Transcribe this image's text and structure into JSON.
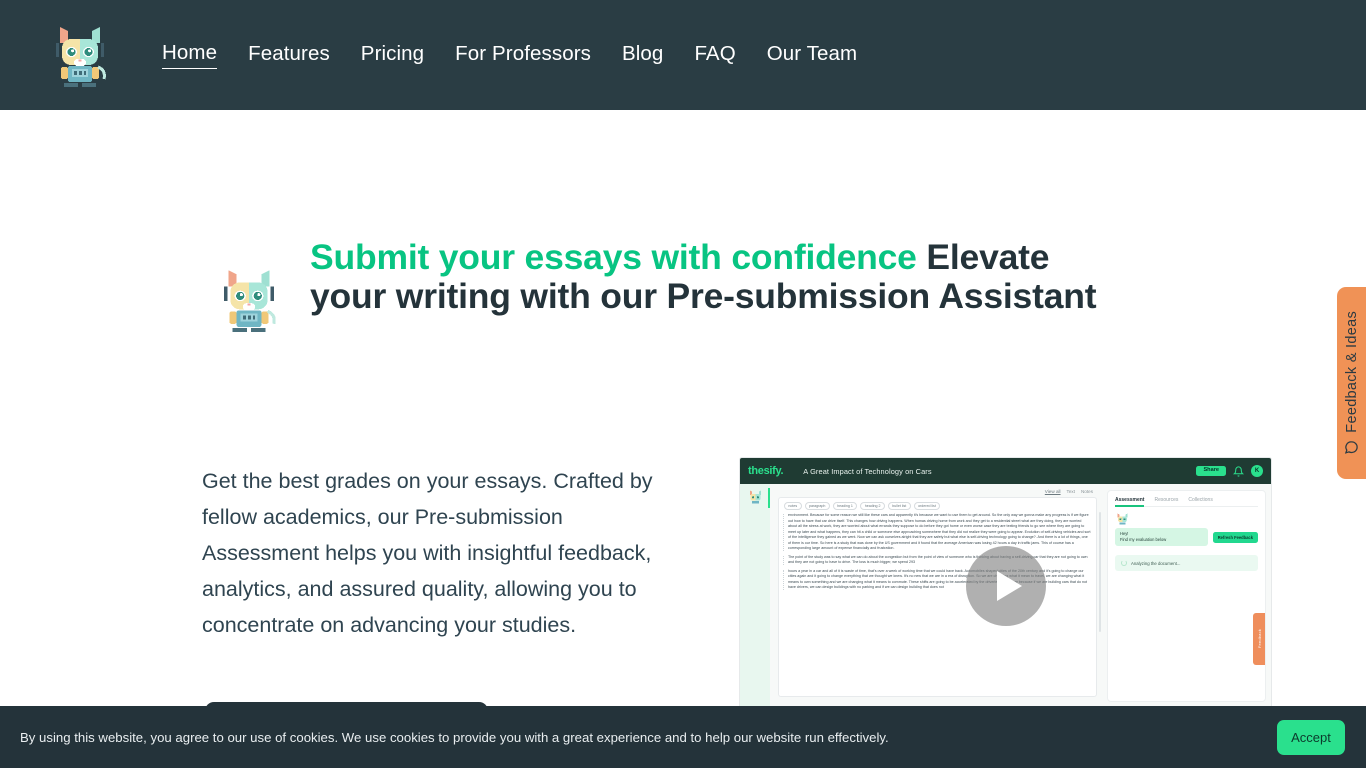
{
  "header": {
    "logo_alt": "thesify robot cat logo",
    "nav": [
      {
        "label": "Home",
        "active": true
      },
      {
        "label": "Features",
        "active": false
      },
      {
        "label": "Pricing",
        "active": false
      },
      {
        "label": "For Professors",
        "active": false
      },
      {
        "label": "Blog",
        "active": false
      },
      {
        "label": "FAQ",
        "active": false
      },
      {
        "label": "Our Team",
        "active": false
      }
    ],
    "bg_color": "#2a3d44"
  },
  "hero": {
    "title_accent": "Submit your essays with confidence",
    "title_rest": " Elevate your writing with our Pre-submission Assistant",
    "accent_color": "#08c482",
    "body": "Get the best grades on your essays. Crafted by fellow academics, our Pre-submission Assessment helps you with insightful feedback, analytics, and assured quality, allowing you to concentrate on advancing your studies.",
    "cta_label": ""
  },
  "video": {
    "app": {
      "logo": "thesify.",
      "doc_title": "A Great Impact of Technology on Cars",
      "share_label": "Share",
      "avatar_initial": "K",
      "bell_icon": "bell-icon",
      "doc_tools": {
        "view_all": "View all",
        "text": "Text",
        "notes": "Notes"
      },
      "chips": [
        "notes",
        "paragraph",
        "heading 1",
        "heading 2",
        "bullet list",
        "ordered list"
      ],
      "paragraphs": [
        "environment. Because for some reason we still like these cars and apparently it's because we want to use them to get around. So the only way we gonna make any progress is if we figure out how to have that car drive itself. This changes how driving happens. When humas driving home from work and they get to a residential street what are they doing, they are worried about all the stress at work, they are worried about what errands they suppose to do before they got home or even worse case they are texting friends to go see where they are going to meet up later and what happens, they can hit a child or someone else approaching somewhere that they did not realize they were going to appear. Evolution of self-driving vehicles and sort of the intelligence they gained as we went. Now we can ask ourselves alright that they are safety but what else is self-driving technology going to change?. And there is a lot of things, one of them is our time. So here is a study that was done by the US government and it found that the average American was losing 42 hours a day in traffic jams. This of course has a corresponding large amount of expense financially and frustration.",
        "The point of the study was to say what we can do about the congestion but from the point of view of someone who is thinking about having a self-driving car that they are not going to own and they are not going to have to drive. The loss is much bigger, we spend 293",
        "hours a year in a car and all of it is waste of time, that's over a week of working time that we could have back. Automobiles shaped cities of the 20th century and it's going to change our cities again and it going to change everything that we thought we knew. It's no new that we are in a era of disruption. So we are changing what it mean to travel, we are changing what it means to own something and we are changing what it means to commute. These shifts are going to be accelerated by the driverless of this car because if we are building cars that do not have drivers, we can design buildings with no parking and if we can design building that does not"
      ],
      "side_tabs": [
        {
          "label": "Assessment",
          "active": true
        },
        {
          "label": "Resources",
          "active": false
        },
        {
          "label": "Collections",
          "active": false
        }
      ],
      "bubble_line1": "Hey!",
      "bubble_line2": "Find my evaluation below",
      "refresh_label": "Refresh Feedback",
      "analyzing_label": "Analyzing the document...",
      "feedback_tab_label": "Feedback"
    },
    "play_icon": "play-icon"
  },
  "feedback_tab": {
    "label": "Feedback & Ideas",
    "icon": "speech-bubble-icon",
    "color": "#f09256"
  },
  "cookie": {
    "text": "By using this website, you agree to our use of cookies. We use cookies to provide you with a great experience and to help our website run effectively.",
    "accept_label": "Accept",
    "accent": "#2ae08d"
  }
}
